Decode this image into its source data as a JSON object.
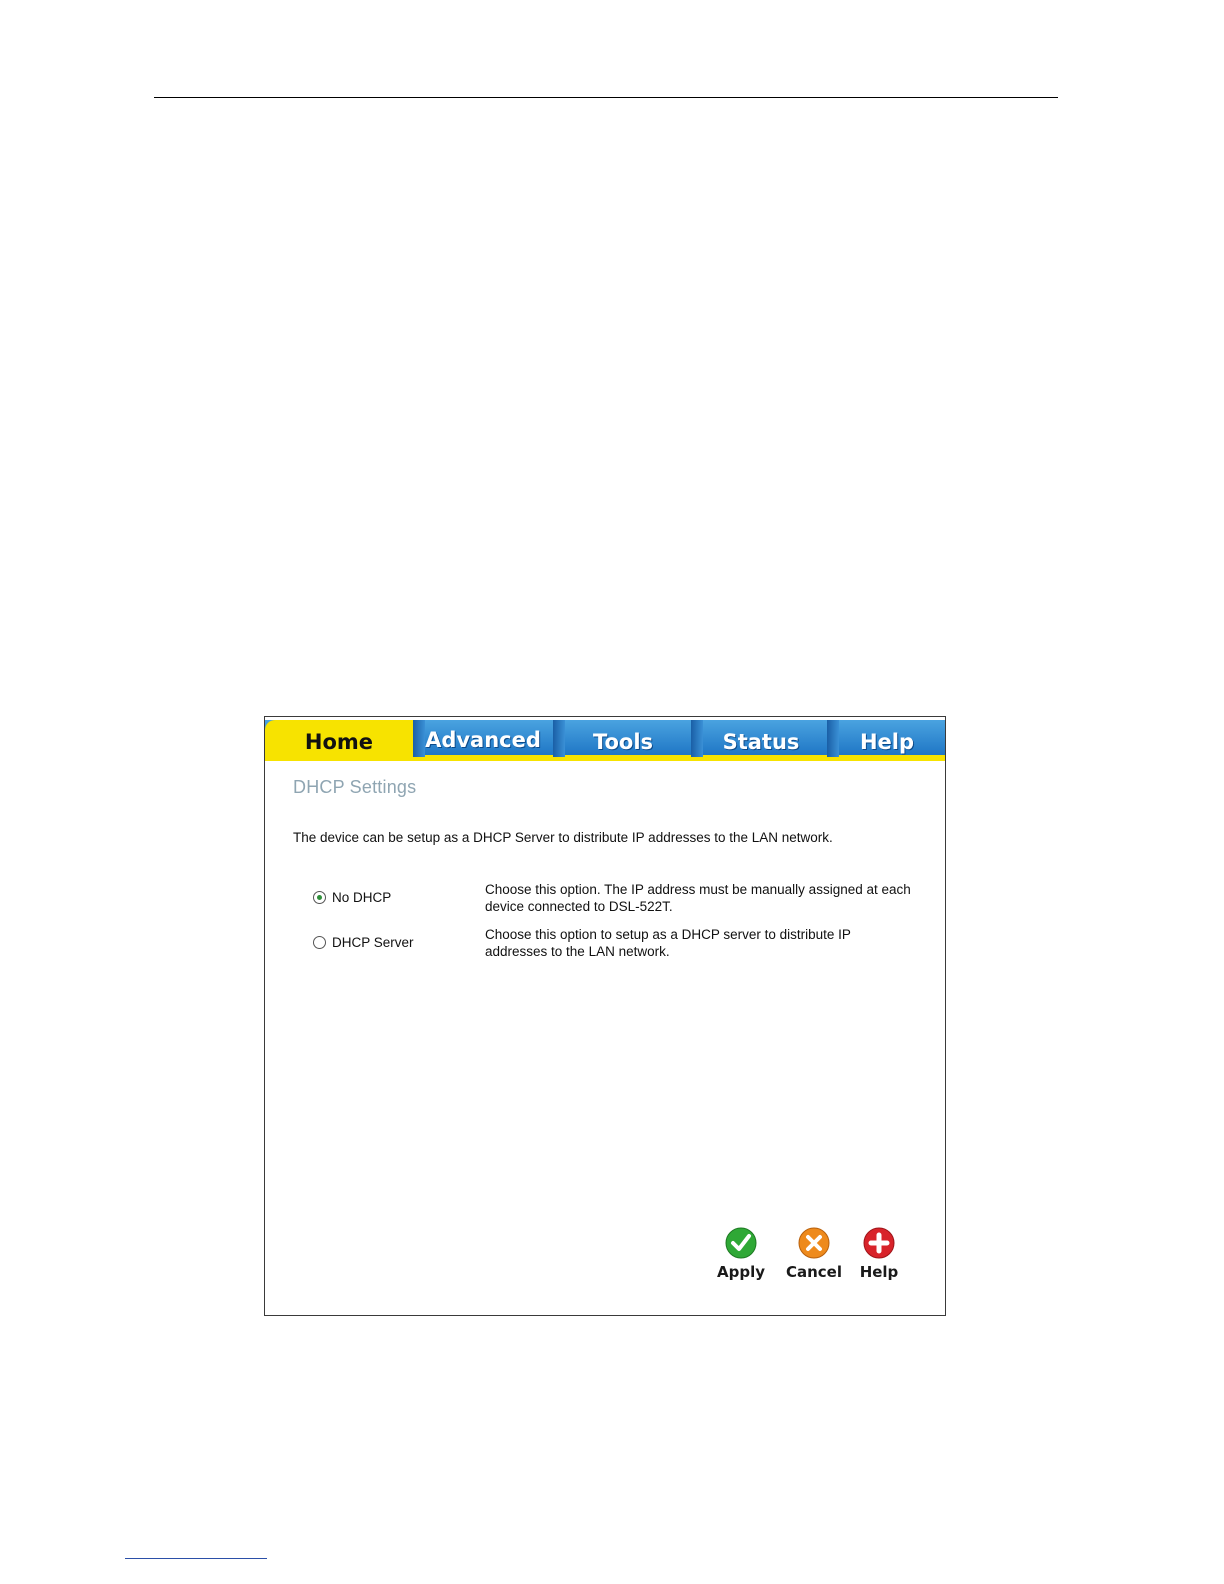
{
  "tabs": [
    {
      "label": "Home",
      "active": true
    },
    {
      "label": "Advanced",
      "active": false
    },
    {
      "label": "Tools",
      "active": false
    },
    {
      "label": "Status",
      "active": false
    },
    {
      "label": "Help",
      "active": false
    }
  ],
  "page": {
    "title": "DHCP Settings",
    "intro": "The device can be setup as a DHCP Server to distribute IP addresses to the LAN network."
  },
  "options": [
    {
      "label": "No DHCP",
      "checked": true,
      "description": "Choose this option. The IP address must be manually assigned at each device connected to DSL-522T."
    },
    {
      "label": "DHCP Server",
      "checked": false,
      "description": "Choose this option to setup as a DHCP server to distribute IP addresses to the LAN network."
    }
  ],
  "actions": {
    "apply_label": "Apply",
    "cancel_label": "Cancel",
    "help_label": "Help"
  },
  "colors": {
    "tab_blue": "#1d74c4",
    "tab_yellow": "#f7e300",
    "title_gray": "#8fa5b2",
    "apply_green": "#2fa836",
    "cancel_orange": "#ee8a1c",
    "help_red": "#d8232a"
  },
  "icons": {
    "apply": "check-icon",
    "cancel": "x-icon",
    "help": "plus-icon"
  }
}
